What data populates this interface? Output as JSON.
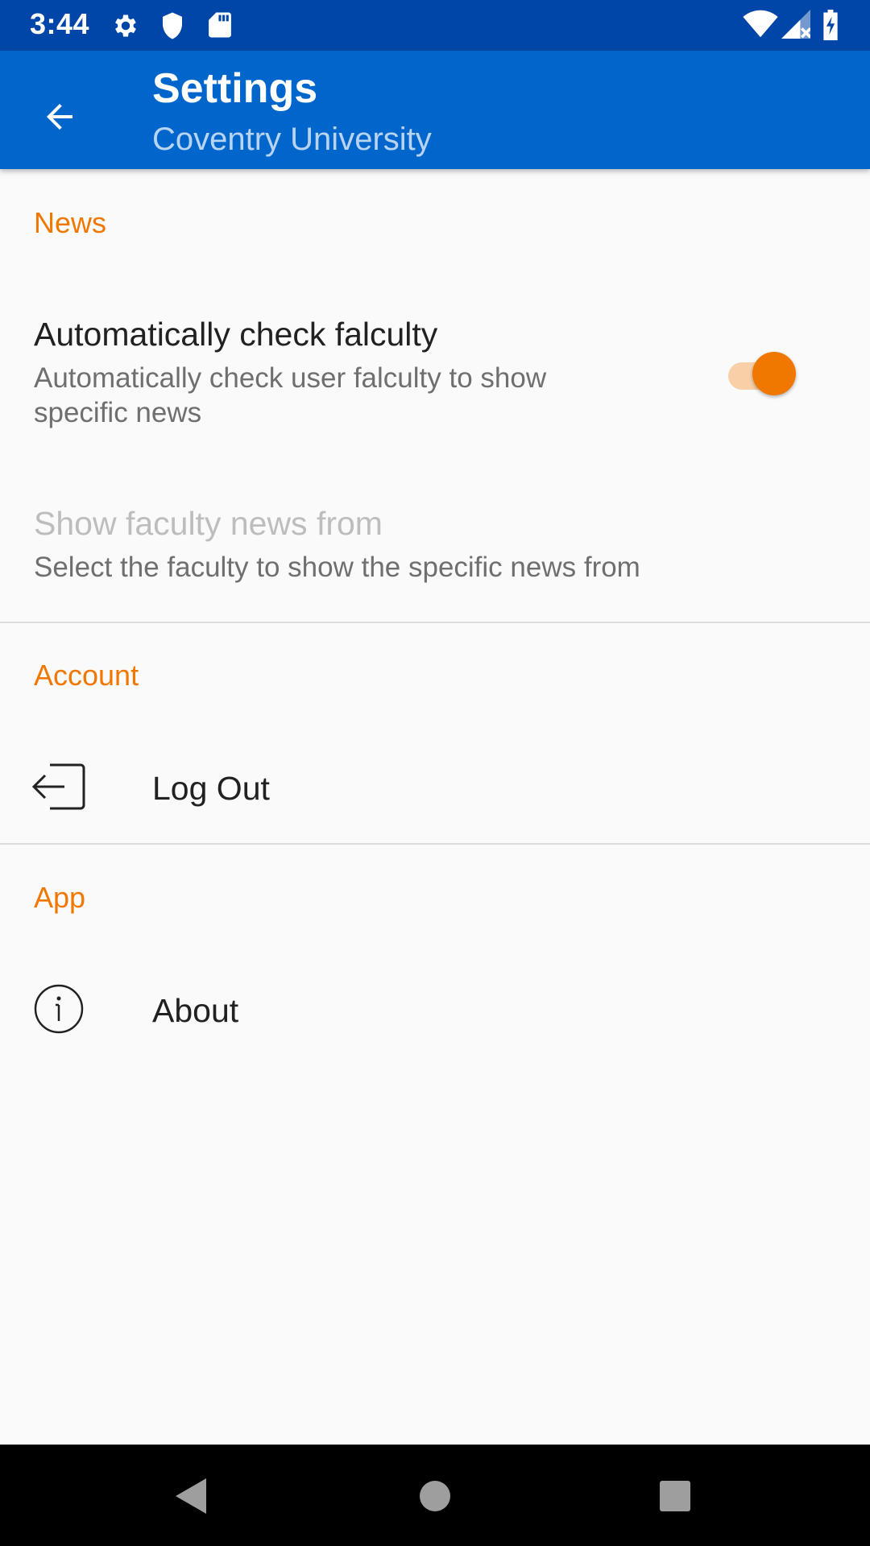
{
  "status_bar": {
    "time": "3:44",
    "left_icons": [
      "gear-icon",
      "shield-icon",
      "sd-card-icon"
    ],
    "right_icons": [
      "wifi-icon",
      "cell-signal-icon",
      "battery-charging-icon"
    ]
  },
  "app_bar": {
    "title": "Settings",
    "subtitle": "Coventry University",
    "color": "#0066cc"
  },
  "sections": {
    "news": {
      "header": "News",
      "auto_check": {
        "title": "Automatically check falculty",
        "summary_line1": "Automatically check user falculty to show",
        "summary_line2": "specific news",
        "enabled": true
      },
      "faculty_news": {
        "title": "Show faculty news from",
        "summary": "Select the faculty to show the specific news from"
      }
    },
    "account": {
      "header": "Account",
      "logout_label": "Log Out"
    },
    "app": {
      "header": "App",
      "about_label": "About"
    }
  },
  "accent_color": "#f07800"
}
